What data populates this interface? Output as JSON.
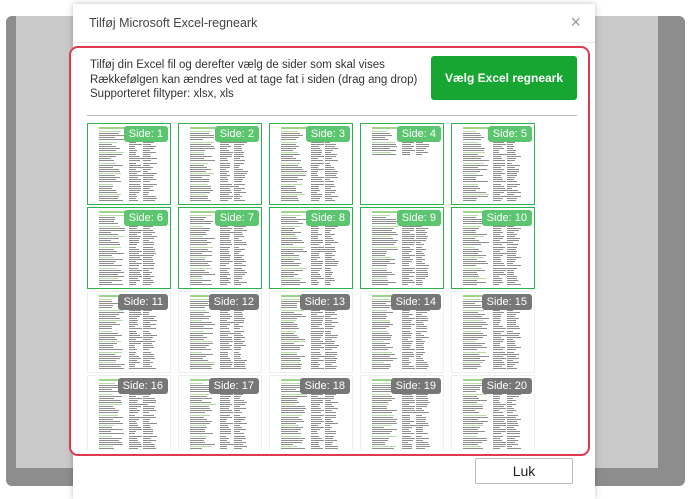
{
  "dialog": {
    "title": "Tilføj Microsoft Excel-regneark",
    "close_symbol": "×",
    "instructions": [
      "Tilføj din Excel fil og derefter vælg de sider som skal vises",
      "Rækkefølgen kan ændres ved at tage fat i siden (drag ang drop)",
      "Supporteret filtyper: xlsx, xls"
    ],
    "choose_button": "Vælg Excel regneark",
    "close_button": "Luk"
  },
  "pages": [
    {
      "label": "Side: 1",
      "selected": true
    },
    {
      "label": "Side: 2",
      "selected": true
    },
    {
      "label": "Side: 3",
      "selected": true
    },
    {
      "label": "Side: 4",
      "selected": true
    },
    {
      "label": "Side: 5",
      "selected": true
    },
    {
      "label": "Side: 6",
      "selected": true
    },
    {
      "label": "Side: 7",
      "selected": true
    },
    {
      "label": "Side: 8",
      "selected": true
    },
    {
      "label": "Side: 9",
      "selected": true
    },
    {
      "label": "Side: 10",
      "selected": true
    },
    {
      "label": "Side: 11",
      "selected": false
    },
    {
      "label": "Side: 12",
      "selected": false
    },
    {
      "label": "Side: 13",
      "selected": false
    },
    {
      "label": "Side: 14",
      "selected": false
    },
    {
      "label": "Side: 15",
      "selected": false
    },
    {
      "label": "Side: 16",
      "selected": false
    },
    {
      "label": "Side: 17",
      "selected": false
    },
    {
      "label": "Side: 18",
      "selected": false
    },
    {
      "label": "Side: 19",
      "selected": false
    },
    {
      "label": "Side: 20",
      "selected": false
    }
  ],
  "colors": {
    "accent_green": "#16a631",
    "selected_badge": "#5cc56f",
    "unselected_badge": "#777777",
    "highlight_red": "#e03a4e"
  }
}
